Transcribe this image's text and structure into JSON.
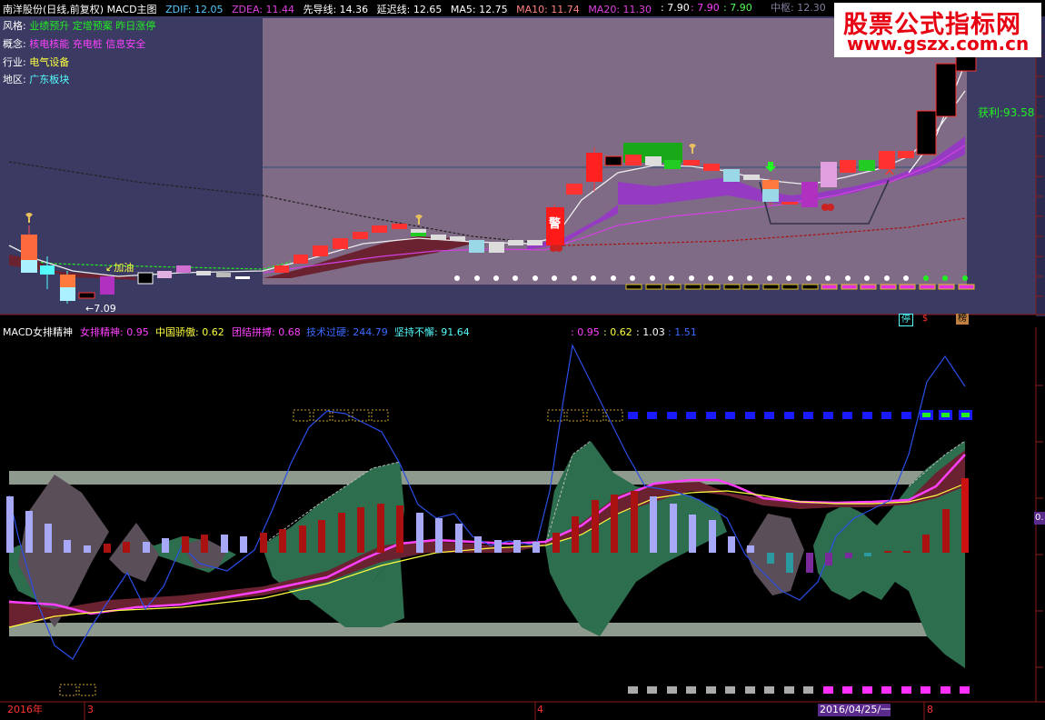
{
  "header": {
    "title": "南洋股份(日线,前复权) MACD主图",
    "zdif": "ZDIF: 12.05",
    "zdea": "ZDEA: 11.44",
    "xdx": "先导线: 14.36",
    "ycx": "延迟线: 12.65",
    "ma5": "MA5: 12.75",
    "ma10": "MA10: 11.74",
    "ma20": "MA20: 11.30",
    "v1": ": 7.90",
    "v2": ": 7.90",
    "v3": ": 7.90",
    "zs": "中枢: 12.30"
  },
  "info": {
    "style_label": "风格:",
    "style_value": "业绩预升 定增预案 昨日涨停",
    "concept_label": "概念:",
    "concept_value": "核电核能 充电桩 信息安全",
    "industry_label": "行业:",
    "industry_value": "电气设备",
    "region_label": "地区:",
    "region_value": "广东板块"
  },
  "watermark": {
    "line1": "股票公式指标网",
    "line2": "www.gszx.com.cn"
  },
  "chart_labels": {
    "profit": "获利:93.58",
    "jiayou": "↙加油",
    "low": "←7.09",
    "jing": "警",
    "tag_ting": "停",
    "tag_s": "$",
    "tag_bang": "榜"
  },
  "indicator": {
    "title": "MACD女排精神",
    "v1": "女排精神: 0.95",
    "v2": "中国骄傲: 0.62",
    "v3": "团结拼搏: 0.68",
    "v4": "技术过硬: 244.79",
    "v5": "坚持不懈: 91.64",
    "r1": ": 0.95",
    "r2": ": 0.62",
    "r3": ": 1.03",
    "r4": ": 1.51",
    "edge": "0."
  },
  "dates": {
    "d1": "2016年",
    "d2": "3",
    "d3": "4",
    "d4": "2016/04/25/一",
    "d5": "8"
  },
  "colors": {
    "up": "#ff3232",
    "down": "#54fcfc",
    "ribbon": "#9933cc",
    "macd_green": "#2d6e4e",
    "macd_gray": "#5a4e58"
  }
}
